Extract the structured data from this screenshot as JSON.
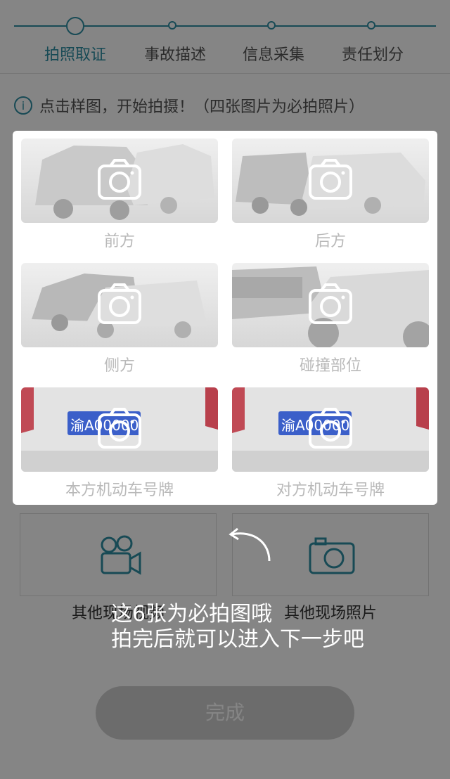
{
  "steps": [
    {
      "label": "拍照取证",
      "active": true
    },
    {
      "label": "事故描述",
      "active": false
    },
    {
      "label": "信息采集",
      "active": false
    },
    {
      "label": "责任划分",
      "active": false
    }
  ],
  "hint": {
    "icon": "info-icon",
    "text": "点击样图，开始拍摄！（四张图片为必拍照片）"
  },
  "photos": [
    {
      "label": "前方",
      "icon": "camera-icon"
    },
    {
      "label": "后方",
      "icon": "camera-icon"
    },
    {
      "label": "侧方",
      "icon": "camera-icon"
    },
    {
      "label": "碰撞部位",
      "icon": "camera-icon"
    },
    {
      "label": "本方机动车号牌",
      "icon": "camera-icon",
      "plate": "渝A00000"
    },
    {
      "label": "对方机动车号牌",
      "icon": "camera-icon",
      "plate": "渝A00000"
    }
  ],
  "extras": [
    {
      "label": "其他现场视频",
      "icon": "video-camera-icon"
    },
    {
      "label": "其他现场照片",
      "icon": "camera-icon"
    }
  ],
  "finish_button": "完成",
  "guide": {
    "line1": "这6张为必拍图哦",
    "line2": "拍完后就可以进入下一步吧",
    "icon": "curved-arrow-icon"
  },
  "colors": {
    "accent": "#2f8fa3",
    "overlay": "rgba(0,0,0,0.48)"
  }
}
